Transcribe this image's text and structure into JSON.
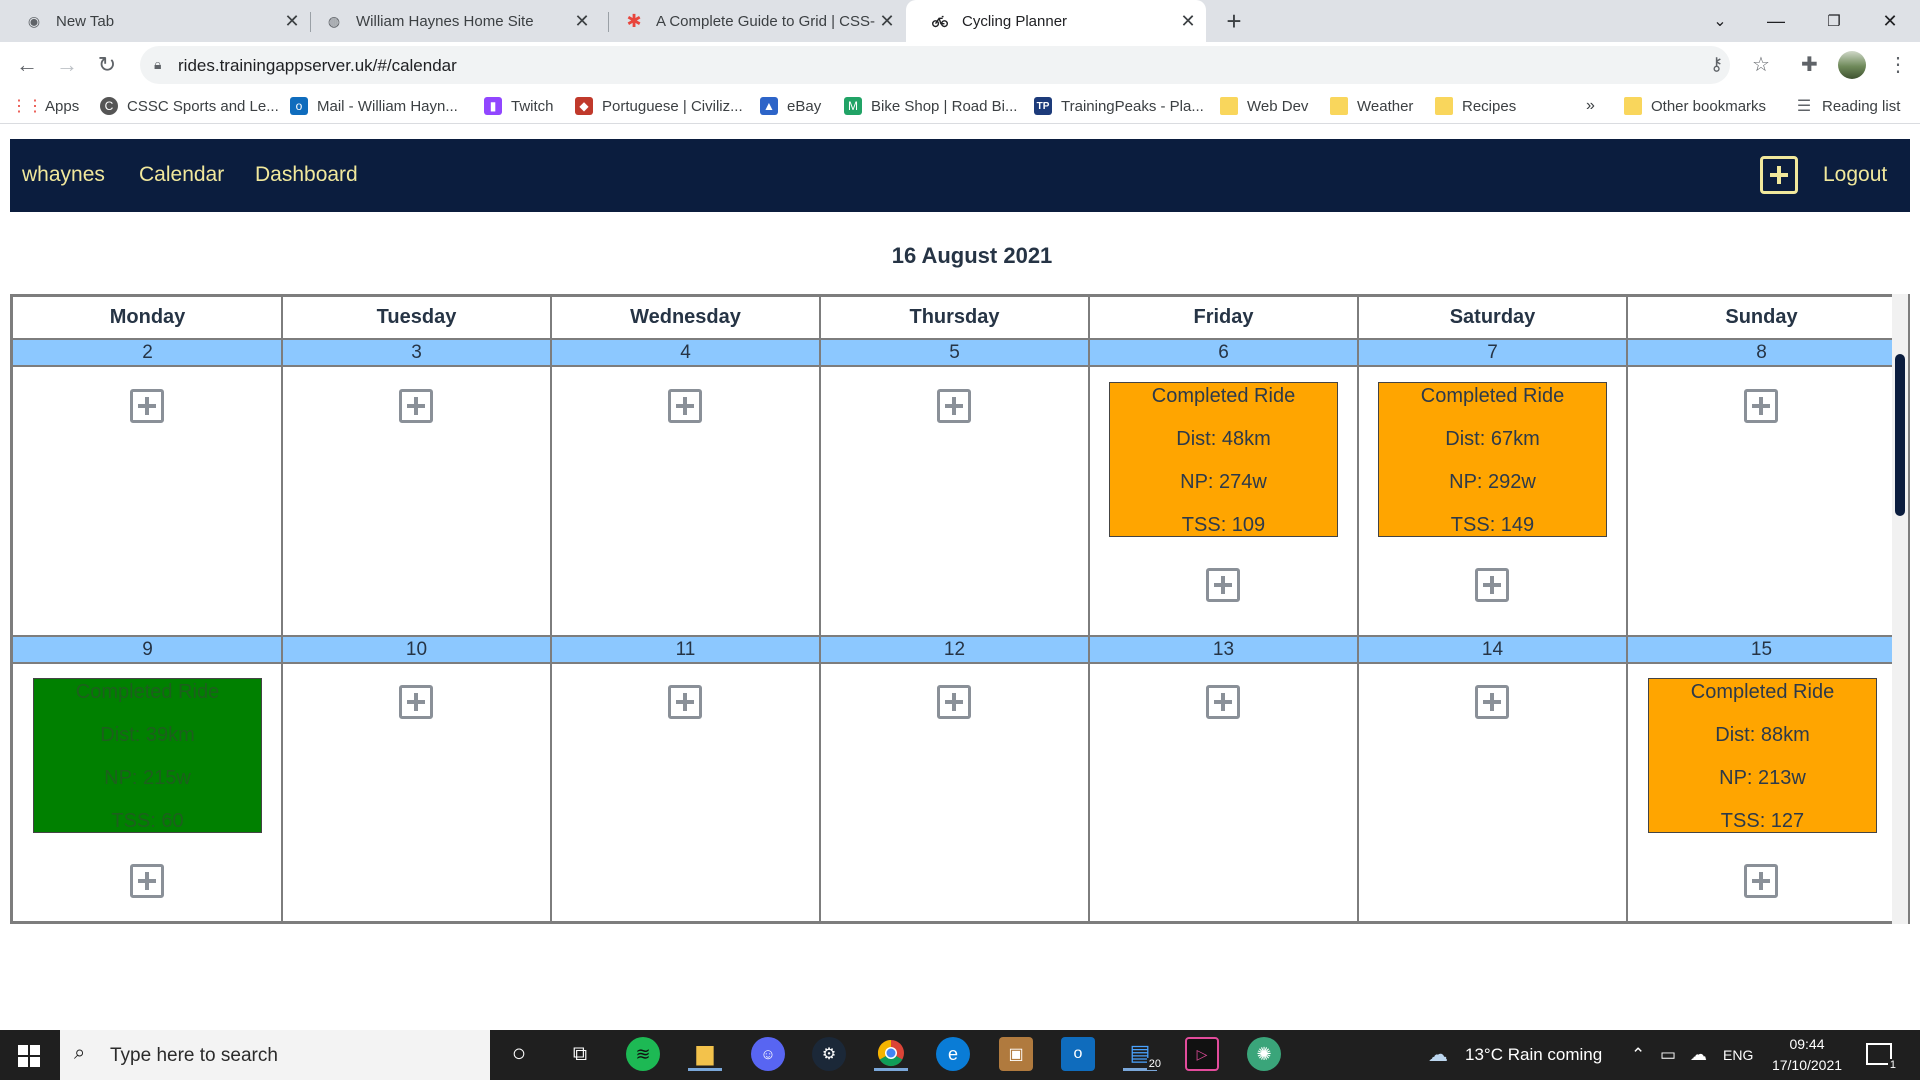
{
  "browser": {
    "tabs": [
      {
        "title": "New Tab",
        "icon": "chrome-icon"
      },
      {
        "title": "William Haynes Home Site",
        "icon": "globe-icon"
      },
      {
        "title": "A Complete Guide to Grid | CSS-T",
        "icon": "css-tricks-icon"
      },
      {
        "title": "Cycling Planner",
        "icon": "bicycle-icon"
      }
    ],
    "url": "rides.trainingappserver.uk/#/calendar",
    "bookmarks": [
      {
        "label": "Apps",
        "icon": "apps-grid-icon",
        "color": "#e8453c"
      },
      {
        "label": "CSSC Sports and Le...",
        "icon": "cssc-icon",
        "color": "#555555"
      },
      {
        "label": "Mail - William Hayn...",
        "icon": "outlook-icon",
        "color": "#0f6cbd"
      },
      {
        "label": "Twitch",
        "icon": "twitch-icon",
        "color": "#9146ff"
      },
      {
        "label": "Portuguese | Civiliz...",
        "icon": "civ-icon",
        "color": "#c0392b"
      },
      {
        "label": "eBay",
        "icon": "ebay-bag-icon",
        "color": "#2d64c8"
      },
      {
        "label": "Bike Shop | Road Bi...",
        "icon": "m-icon",
        "color": "#21a366"
      },
      {
        "label": "TrainingPeaks - Pla...",
        "icon": "tp-icon",
        "color": "#1d3b7a"
      },
      {
        "label": "Web Dev",
        "icon": "folder-icon",
        "color": "#f9d65c"
      },
      {
        "label": "Weather",
        "icon": "folder-icon",
        "color": "#f9d65c"
      },
      {
        "label": "Recipes",
        "icon": "folder-icon",
        "color": "#f9d65c"
      }
    ],
    "bookmarks_overflow": "»",
    "other_bookmarks": "Other bookmarks",
    "reading_list": "Reading list"
  },
  "app": {
    "nav": {
      "user": "whaynes",
      "calendar": "Calendar",
      "dashboard": "Dashboard",
      "logout": "Logout"
    },
    "title": "16 August 2021",
    "weekdays": [
      "Monday",
      "Tuesday",
      "Wednesday",
      "Thursday",
      "Friday",
      "Saturday",
      "Sunday"
    ],
    "weeks": [
      {
        "dates": [
          "2",
          "3",
          "4",
          "5",
          "6",
          "7",
          "8"
        ]
      },
      {
        "dates": [
          "9",
          "10",
          "11",
          "12",
          "13",
          "14",
          "15"
        ]
      }
    ],
    "rides": [
      {
        "status": "Completed Ride",
        "dist": "Dist: 48km",
        "np": "NP: 274w",
        "tss": "TSS: 109",
        "color": "#ffa500",
        "day": "6"
      },
      {
        "status": "Completed Ride",
        "dist": "Dist: 67km",
        "np": "NP: 292w",
        "tss": "TSS: 149",
        "color": "#ffa500",
        "day": "7"
      },
      {
        "status": "Completed Ride",
        "dist": "Dist: 39km",
        "np": "NP: 215w",
        "tss": "TSS: 60",
        "color": "#008000",
        "day": "9"
      },
      {
        "status": "Completed Ride",
        "dist": "Dist: 88km",
        "np": "NP: 213w",
        "tss": "TSS: 127",
        "color": "#ffa500",
        "day": "15"
      }
    ]
  },
  "taskbar": {
    "search_placeholder": "Type here to search",
    "weather": "13°C  Rain coming",
    "language": "ENG",
    "time": "09:44",
    "date": "17/10/2021",
    "explorer_badge": "20",
    "notification_count": "1"
  }
}
